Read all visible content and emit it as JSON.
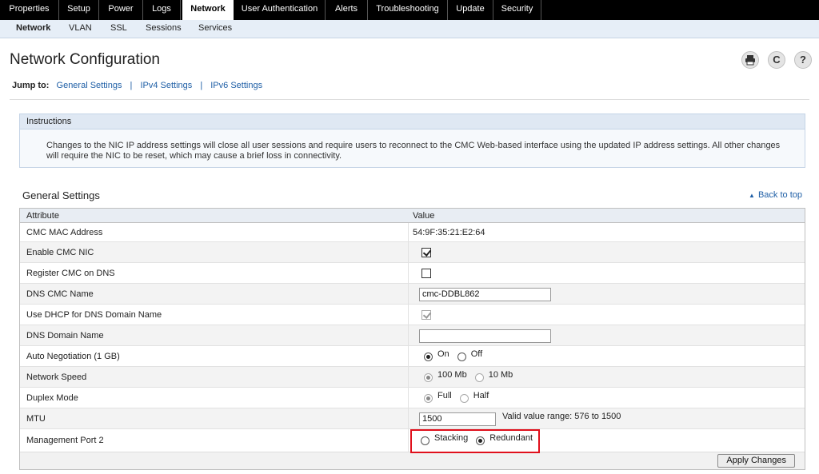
{
  "top_tabs": [
    {
      "label": "Properties",
      "active": false
    },
    {
      "label": "Setup",
      "active": false
    },
    {
      "label": "Power",
      "active": false
    },
    {
      "label": "Logs",
      "active": false
    },
    {
      "label": "Network",
      "active": true
    },
    {
      "label": "User Authentication",
      "active": false
    },
    {
      "label": "Alerts",
      "active": false
    },
    {
      "label": "Troubleshooting",
      "active": false
    },
    {
      "label": "Update",
      "active": false
    },
    {
      "label": "Security",
      "active": false
    }
  ],
  "sub_tabs": [
    {
      "label": "Network",
      "active": true
    },
    {
      "label": "VLAN",
      "active": false
    },
    {
      "label": "SSL",
      "active": false
    },
    {
      "label": "Sessions",
      "active": false
    },
    {
      "label": "Services",
      "active": false
    }
  ],
  "page": {
    "title": "Network Configuration"
  },
  "header_icons": {
    "print": "print-icon",
    "refresh": "refresh-icon",
    "help": "help-icon",
    "refresh_glyph": "C",
    "help_glyph": "?"
  },
  "jump_to": {
    "label": "Jump to:",
    "links": [
      "General Settings",
      "IPv4 Settings",
      "IPv6 Settings"
    ],
    "separator": "|"
  },
  "instructions": {
    "title": "Instructions",
    "text": "Changes to the NIC IP address settings will close all user sessions and require users to reconnect to the CMC Web-based interface using the updated IP address settings. All other changes will require the NIC to be reset, which may cause a brief loss in connectivity."
  },
  "general_settings": {
    "title": "General Settings",
    "back_to_top": "Back to top",
    "col_attribute": "Attribute",
    "col_value": "Value",
    "rows": {
      "mac": {
        "label": "CMC MAC Address",
        "value": "54:9F:35:21:E2:64"
      },
      "enable_nic": {
        "label": "Enable CMC NIC",
        "checked": true
      },
      "register_dns": {
        "label": "Register CMC on DNS",
        "checked": false
      },
      "dns_name": {
        "label": "DNS CMC Name",
        "value": "cmc-DDBL862"
      },
      "use_dhcp": {
        "label": "Use DHCP for DNS Domain Name",
        "checked": true,
        "disabled": true
      },
      "dns_domain": {
        "label": "DNS Domain Name",
        "value": ""
      },
      "auto_neg": {
        "label": "Auto Negotiation (1 GB)",
        "options": [
          "On",
          "Off"
        ],
        "selected": "On"
      },
      "net_speed": {
        "label": "Network Speed",
        "options": [
          "100 Mb",
          "10 Mb"
        ],
        "selected": "100 Mb",
        "disabled": true
      },
      "duplex": {
        "label": "Duplex Mode",
        "options": [
          "Full",
          "Half"
        ],
        "selected": "Full",
        "disabled": true
      },
      "mtu": {
        "label": "MTU",
        "value": "1500",
        "hint": "Valid value range: 576 to 1500"
      },
      "mgmt_port2": {
        "label": "Management Port 2",
        "options": [
          "Stacking",
          "Redundant"
        ],
        "selected": "Redundant"
      }
    },
    "apply_label": "Apply Changes"
  },
  "colors": {
    "topnav_bg": "#000000",
    "subnav_bg": "#e6eef7",
    "link": "#1f5fa6",
    "highlight": "#e0101c"
  }
}
